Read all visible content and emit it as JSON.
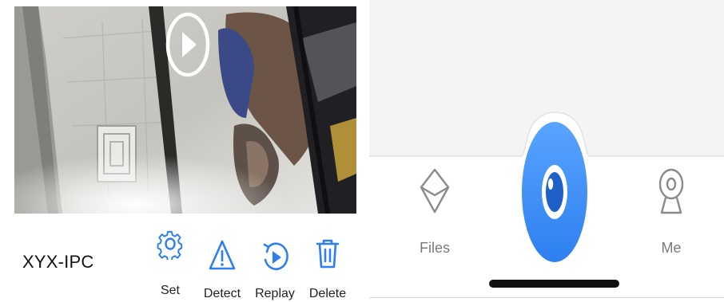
{
  "camera_card": {
    "device_name": "XYX-IPC",
    "play_icon": "play-circle-icon",
    "actions": [
      {
        "label": "Set",
        "icon": "gear-icon"
      },
      {
        "label": "Detect",
        "icon": "warning-triangle-icon"
      },
      {
        "label": "Replay",
        "icon": "replay-icon"
      },
      {
        "label": "Delete",
        "icon": "trash-icon"
      }
    ]
  },
  "tab_bar": {
    "tabs": [
      {
        "label": "Files",
        "icon": "envelope-box-icon"
      },
      {
        "label": "",
        "icon": "eye-camera-icon"
      },
      {
        "label": "Me",
        "icon": "webcam-icon"
      }
    ]
  },
  "colors": {
    "accent_blue": "#2d7ff0",
    "accent_blue_light": "#5aa4ff",
    "icon_gray": "#7a7a7a",
    "tab_bar_top_gray": "#f4f4f4"
  }
}
